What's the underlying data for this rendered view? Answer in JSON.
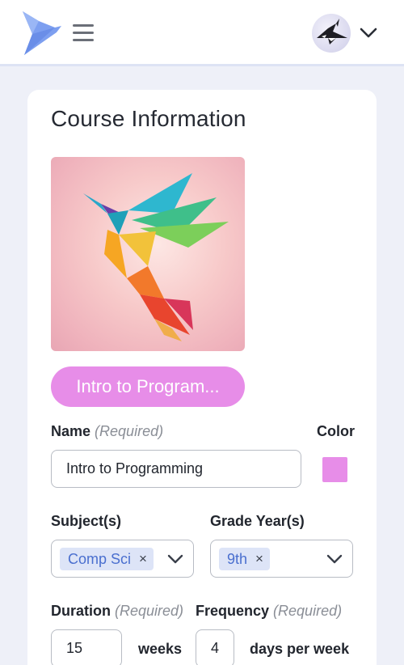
{
  "header": {
    "logo_icon": "paper-plane-bird-logo",
    "menu_icon": "hamburger-menu-icon",
    "avatar_icon": "origami-orca-avatar",
    "avatar_dropdown_icon": "chevron-down-icon"
  },
  "card": {
    "title": "Course Information",
    "image_icon": "origami-hummingbird-image",
    "course_button_label": "Intro to Program...",
    "name_label": "Name",
    "name_required": "(Required)",
    "name_value": "Intro to Programming",
    "color_label": "Color",
    "color_value": "#e78de8",
    "subjects_label": "Subject(s)",
    "subjects_chips": [
      "Comp Sci"
    ],
    "grade_label": "Grade Year(s)",
    "grade_chips": [
      "9th"
    ],
    "chip_remove_glyph": "×",
    "duration_label": "Duration",
    "duration_required": "(Required)",
    "duration_value": "15",
    "duration_unit": "weeks",
    "frequency_label": "Frequency",
    "frequency_required": "(Required)",
    "frequency_value": "4",
    "frequency_unit": "days per week"
  },
  "colors": {
    "accent": "#e78de8",
    "chip_bg": "#dde4f7",
    "chip_text": "#4a6fcf",
    "logo": "#7d9ff0",
    "page_bg": "#eef0f8"
  }
}
